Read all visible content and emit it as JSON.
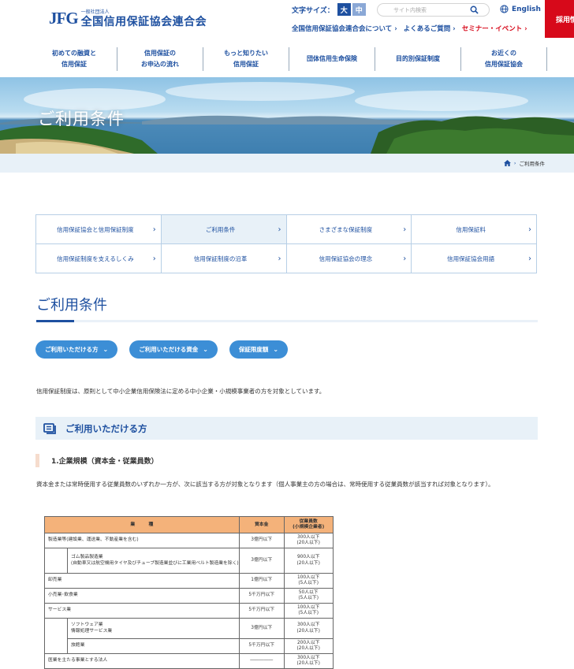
{
  "header": {
    "logo_mark": "JFG",
    "logo_small": "一般社団法人",
    "logo_name": "全国信用保証協会連合会",
    "font_size_label": "文字サイズ：",
    "font_large": "大",
    "font_medium": "中",
    "search_placeholder": "サイト内検索",
    "english": "English",
    "recruit": "採用情報",
    "links": [
      {
        "label": "全国信用保証協会連合会について ›"
      },
      {
        "label": "よくあるご質問 ›"
      },
      {
        "label": "セミナー・イベント ›"
      }
    ]
  },
  "gnav": [
    {
      "label": "初めての融資と\n信用保証"
    },
    {
      "label": "信用保証の\nお申込の流れ"
    },
    {
      "label": "もっと知りたい\n信用保証"
    },
    {
      "label": "団体信用生命保険"
    },
    {
      "label": "目的別保証制度"
    },
    {
      "label": "お近くの\n信用保証協会"
    }
  ],
  "hero": {
    "title": "ご利用条件"
  },
  "breadcrumb": {
    "current": "ご利用条件"
  },
  "subnav": [
    [
      "信用保証協会と信用保証制度",
      "ご利用条件",
      "さまざまな保証制度",
      "信用保証料"
    ],
    [
      "信用保証制度を支えるしくみ",
      "信用保証制度の沿革",
      "信用保証協会の理念",
      "信用保証協会用語"
    ]
  ],
  "page": {
    "title": "ご利用条件",
    "pills": [
      "ご利用いただける方",
      "ご利用いただける資金",
      "保証限度額"
    ],
    "intro": "信用保証制度は、原則として中小企業信用保険法に定める中小企業・小規模事業者の方を対象としています。",
    "section_title": "ご利用いただける方",
    "sub_title": "1.企業規模（資本金・従業員数）",
    "paragraph": "資本金または常時使用する従業員数のいずれか一方が、次に該当する方が対象となります（個人事業主の方の場合は、常時使用する従業員数が該当すれば対象となります）。"
  },
  "table": {
    "headers": [
      "業　　　種",
      "資本金",
      "従業員数\n(小規模企業者)"
    ],
    "rows": [
      {
        "industry": "製造業等(建設業、運送業、不動産業を含む)",
        "capital": "3億円以下",
        "employees": "300人以下\n(20人以下)"
      },
      {
        "industry": "ゴム製品製造業\n(自動車又は航空機用タイヤ及びチューブ製造業並びに工業用ベルト製造業を除く)",
        "capital": "3億円以下",
        "employees": "900人以下\n(20人以下)"
      },
      {
        "industry": "卸売業",
        "capital": "1億円以下",
        "employees": "100人以下\n(5人以下)"
      },
      {
        "industry": "小売業･飲食業",
        "capital": "5千万円以下",
        "employees": "50人以下\n(5人以下)"
      },
      {
        "industry": "サービス業",
        "capital": "5千万円以下",
        "employees": "100人以下\n(5人以下)"
      },
      {
        "industry": "ソフトウェア業\n情報処理サービス業",
        "capital": "3億円以下",
        "employees": "300人以下\n(20人以下)"
      },
      {
        "industry": "旅館業",
        "capital": "5千万円以下",
        "employees": "200人以下\n(20人以下)"
      },
      {
        "industry": "医業を主たる事業とする法人",
        "capital": "―――――",
        "employees": "300人以下\n(20人以下)"
      }
    ]
  },
  "colors": {
    "brand": "#1e50a0",
    "accent_red": "#d7091a",
    "pill": "#3c8ed6",
    "table_head": "#f4b27a"
  }
}
